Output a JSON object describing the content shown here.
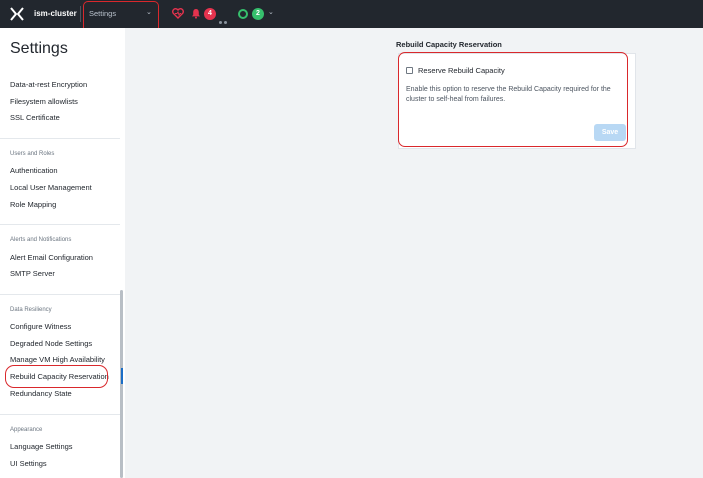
{
  "topbar": {
    "cluster_name": "ism-cluster",
    "menu_label": "Settings",
    "alert_count": "4",
    "task_count": "2"
  },
  "sidebar": {
    "title": "Settings",
    "items": [
      {
        "label": "Data-at-rest Encryption"
      },
      {
        "label": "Filesystem allowlists"
      },
      {
        "label": "SSL Certificate"
      },
      {
        "label": "Authentication"
      },
      {
        "label": "Local User Management"
      },
      {
        "label": "Role Mapping"
      },
      {
        "label": "Alert Email Configuration"
      },
      {
        "label": "SMTP Server"
      },
      {
        "label": "Configure Witness"
      },
      {
        "label": "Degraded Node Settings"
      },
      {
        "label": "Manage VM High Availability"
      },
      {
        "label": "Rebuild Capacity Reservation",
        "active": true
      },
      {
        "label": "Redundancy State"
      },
      {
        "label": "Language Settings"
      },
      {
        "label": "UI Settings"
      }
    ],
    "sections": {
      "users_and_roles": "Users and Roles",
      "alerts_and_notifications": "Alerts and Notifications",
      "data_resiliency": "Data Resiliency",
      "appearance": "Appearance"
    }
  },
  "main": {
    "section_title": "Rebuild Capacity Reservation",
    "checkbox_label": "Reserve Rebuild Capacity",
    "checkbox_checked": false,
    "description": "Enable this option to reserve the Rebuild Capacity required for the cluster to self-heal from failures.",
    "save_label": "Save"
  },
  "colors": {
    "topbar_bg": "#22272e",
    "highlight_red": "#d9282c",
    "alert_badge": "#e5334e",
    "task_badge": "#36c06d",
    "active_accent": "#1b6dc6",
    "save_disabled": "#b8d8f4"
  }
}
